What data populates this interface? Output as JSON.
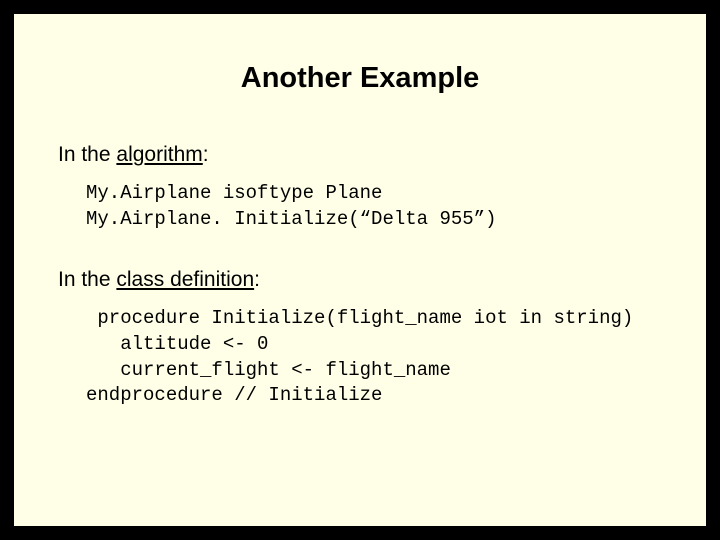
{
  "title": "Another Example",
  "section1": {
    "lead": "In the ",
    "underlined": "algorithm",
    "tail": ":"
  },
  "code1": "My.Airplane isoftype Plane\nMy.Airplane. Initialize(“Delta 955”)",
  "section2": {
    "lead": "In the ",
    "underlined": "class definition",
    "tail": ":"
  },
  "code2": " procedure Initialize(flight_name iot in string)\n   altitude <- 0\n   current_flight <- flight_name\nendprocedure // Initialize"
}
